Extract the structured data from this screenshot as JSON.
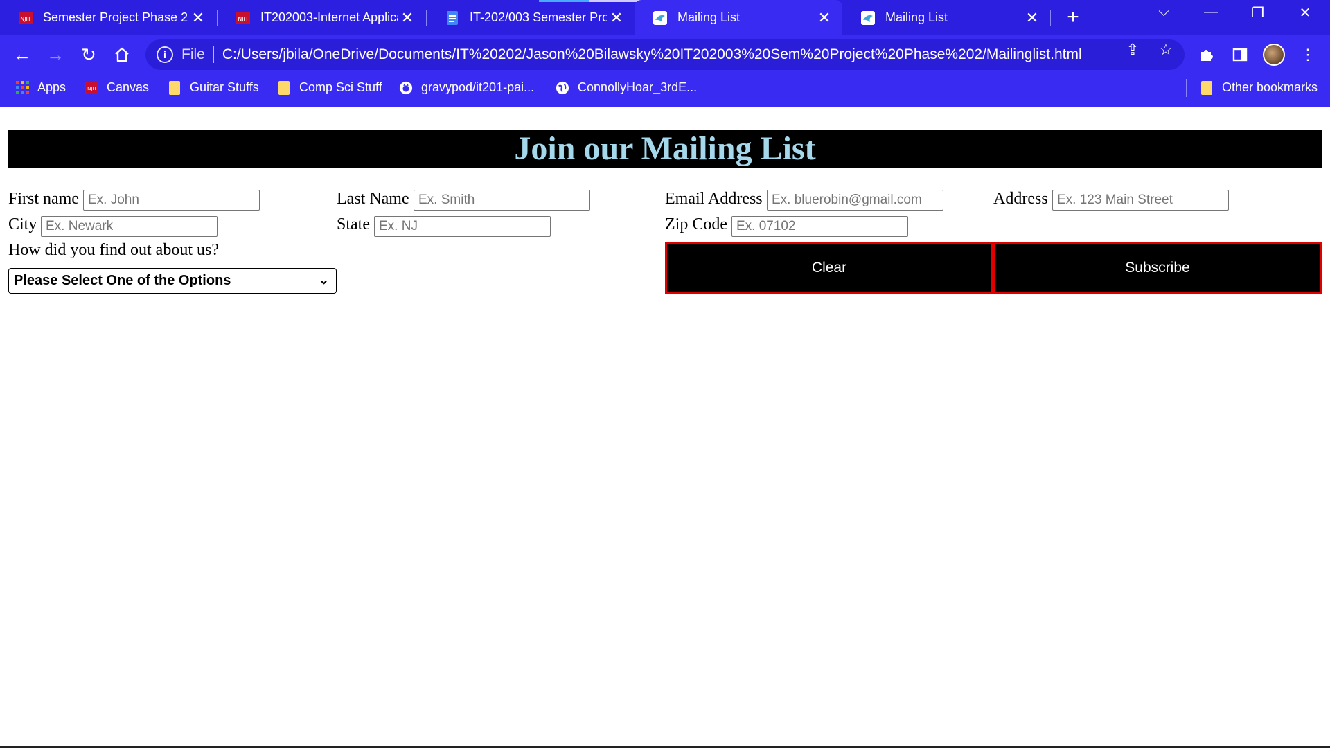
{
  "browser": {
    "tabs": [
      {
        "title": "Semester Project Phase 2",
        "favicon": "njit-icon"
      },
      {
        "title": "IT202003-Internet Applica",
        "favicon": "njit-icon"
      },
      {
        "title": "IT-202/003 Semester Proj",
        "favicon": "docs-icon"
      },
      {
        "title": "Mailing List",
        "favicon": "page-bird-icon",
        "active": true
      },
      {
        "title": "Mailing List",
        "favicon": "page-bird-icon"
      }
    ],
    "address": {
      "scheme": "File",
      "url": "C:/Users/jbila/OneDrive/Documents/IT%20202/Jason%20Bilawsky%20IT202003%20Sem%20Project%20Phase%202/Mailinglist.html"
    },
    "bookmarks": [
      "Apps",
      "Canvas",
      "Guitar Stuffs",
      "Comp Sci Stuff",
      "gravypod/it201-pai...",
      "ConnollyHoar_3rdE..."
    ],
    "other_bookmarks": "Other bookmarks",
    "colors": {
      "chrome": "#3a2bf2",
      "tabstrip": "#2c1fe0"
    }
  },
  "page": {
    "heading": "Join our Mailing List",
    "fields": {
      "first_name": {
        "label": "First name",
        "placeholder": "Ex. John"
      },
      "last_name": {
        "label": "Last Name",
        "placeholder": "Ex. Smith"
      },
      "email": {
        "label": "Email Address",
        "placeholder": "Ex. bluerobin@gmail.com"
      },
      "address": {
        "label": "Address",
        "placeholder": "Ex. 123 Main Street"
      },
      "city": {
        "label": "City",
        "placeholder": "Ex. Newark"
      },
      "state": {
        "label": "State",
        "placeholder": "Ex. NJ"
      },
      "zip": {
        "label": "Zip Code",
        "placeholder": "Ex. 07102"
      }
    },
    "question": "How did you find out about us?",
    "select_value": "Please Select One of the Options",
    "buttons": {
      "clear": "Clear",
      "subscribe": "Subscribe"
    },
    "colors": {
      "banner_bg": "#000000",
      "heading": "#a4d8ea",
      "button_border": "#e00000"
    }
  }
}
